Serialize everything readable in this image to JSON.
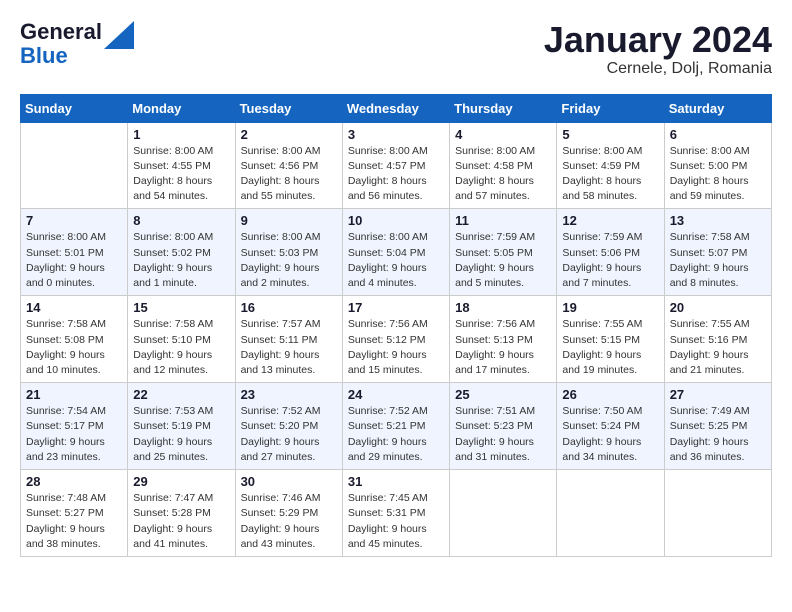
{
  "logo": {
    "line1": "General",
    "line2": "Blue"
  },
  "title": "January 2024",
  "subtitle": "Cernele, Dolj, Romania",
  "headers": [
    "Sunday",
    "Monday",
    "Tuesday",
    "Wednesday",
    "Thursday",
    "Friday",
    "Saturday"
  ],
  "weeks": [
    [
      {
        "day": "",
        "info": ""
      },
      {
        "day": "1",
        "info": "Sunrise: 8:00 AM\nSunset: 4:55 PM\nDaylight: 8 hours\nand 54 minutes."
      },
      {
        "day": "2",
        "info": "Sunrise: 8:00 AM\nSunset: 4:56 PM\nDaylight: 8 hours\nand 55 minutes."
      },
      {
        "day": "3",
        "info": "Sunrise: 8:00 AM\nSunset: 4:57 PM\nDaylight: 8 hours\nand 56 minutes."
      },
      {
        "day": "4",
        "info": "Sunrise: 8:00 AM\nSunset: 4:58 PM\nDaylight: 8 hours\nand 57 minutes."
      },
      {
        "day": "5",
        "info": "Sunrise: 8:00 AM\nSunset: 4:59 PM\nDaylight: 8 hours\nand 58 minutes."
      },
      {
        "day": "6",
        "info": "Sunrise: 8:00 AM\nSunset: 5:00 PM\nDaylight: 8 hours\nand 59 minutes."
      }
    ],
    [
      {
        "day": "7",
        "info": "Sunrise: 8:00 AM\nSunset: 5:01 PM\nDaylight: 9 hours\nand 0 minutes."
      },
      {
        "day": "8",
        "info": "Sunrise: 8:00 AM\nSunset: 5:02 PM\nDaylight: 9 hours\nand 1 minute."
      },
      {
        "day": "9",
        "info": "Sunrise: 8:00 AM\nSunset: 5:03 PM\nDaylight: 9 hours\nand 2 minutes."
      },
      {
        "day": "10",
        "info": "Sunrise: 8:00 AM\nSunset: 5:04 PM\nDaylight: 9 hours\nand 4 minutes."
      },
      {
        "day": "11",
        "info": "Sunrise: 7:59 AM\nSunset: 5:05 PM\nDaylight: 9 hours\nand 5 minutes."
      },
      {
        "day": "12",
        "info": "Sunrise: 7:59 AM\nSunset: 5:06 PM\nDaylight: 9 hours\nand 7 minutes."
      },
      {
        "day": "13",
        "info": "Sunrise: 7:58 AM\nSunset: 5:07 PM\nDaylight: 9 hours\nand 8 minutes."
      }
    ],
    [
      {
        "day": "14",
        "info": "Sunrise: 7:58 AM\nSunset: 5:08 PM\nDaylight: 9 hours\nand 10 minutes."
      },
      {
        "day": "15",
        "info": "Sunrise: 7:58 AM\nSunset: 5:10 PM\nDaylight: 9 hours\nand 12 minutes."
      },
      {
        "day": "16",
        "info": "Sunrise: 7:57 AM\nSunset: 5:11 PM\nDaylight: 9 hours\nand 13 minutes."
      },
      {
        "day": "17",
        "info": "Sunrise: 7:56 AM\nSunset: 5:12 PM\nDaylight: 9 hours\nand 15 minutes."
      },
      {
        "day": "18",
        "info": "Sunrise: 7:56 AM\nSunset: 5:13 PM\nDaylight: 9 hours\nand 17 minutes."
      },
      {
        "day": "19",
        "info": "Sunrise: 7:55 AM\nSunset: 5:15 PM\nDaylight: 9 hours\nand 19 minutes."
      },
      {
        "day": "20",
        "info": "Sunrise: 7:55 AM\nSunset: 5:16 PM\nDaylight: 9 hours\nand 21 minutes."
      }
    ],
    [
      {
        "day": "21",
        "info": "Sunrise: 7:54 AM\nSunset: 5:17 PM\nDaylight: 9 hours\nand 23 minutes."
      },
      {
        "day": "22",
        "info": "Sunrise: 7:53 AM\nSunset: 5:19 PM\nDaylight: 9 hours\nand 25 minutes."
      },
      {
        "day": "23",
        "info": "Sunrise: 7:52 AM\nSunset: 5:20 PM\nDaylight: 9 hours\nand 27 minutes."
      },
      {
        "day": "24",
        "info": "Sunrise: 7:52 AM\nSunset: 5:21 PM\nDaylight: 9 hours\nand 29 minutes."
      },
      {
        "day": "25",
        "info": "Sunrise: 7:51 AM\nSunset: 5:23 PM\nDaylight: 9 hours\nand 31 minutes."
      },
      {
        "day": "26",
        "info": "Sunrise: 7:50 AM\nSunset: 5:24 PM\nDaylight: 9 hours\nand 34 minutes."
      },
      {
        "day": "27",
        "info": "Sunrise: 7:49 AM\nSunset: 5:25 PM\nDaylight: 9 hours\nand 36 minutes."
      }
    ],
    [
      {
        "day": "28",
        "info": "Sunrise: 7:48 AM\nSunset: 5:27 PM\nDaylight: 9 hours\nand 38 minutes."
      },
      {
        "day": "29",
        "info": "Sunrise: 7:47 AM\nSunset: 5:28 PM\nDaylight: 9 hours\nand 41 minutes."
      },
      {
        "day": "30",
        "info": "Sunrise: 7:46 AM\nSunset: 5:29 PM\nDaylight: 9 hours\nand 43 minutes."
      },
      {
        "day": "31",
        "info": "Sunrise: 7:45 AM\nSunset: 5:31 PM\nDaylight: 9 hours\nand 45 minutes."
      },
      {
        "day": "",
        "info": ""
      },
      {
        "day": "",
        "info": ""
      },
      {
        "day": "",
        "info": ""
      }
    ]
  ]
}
